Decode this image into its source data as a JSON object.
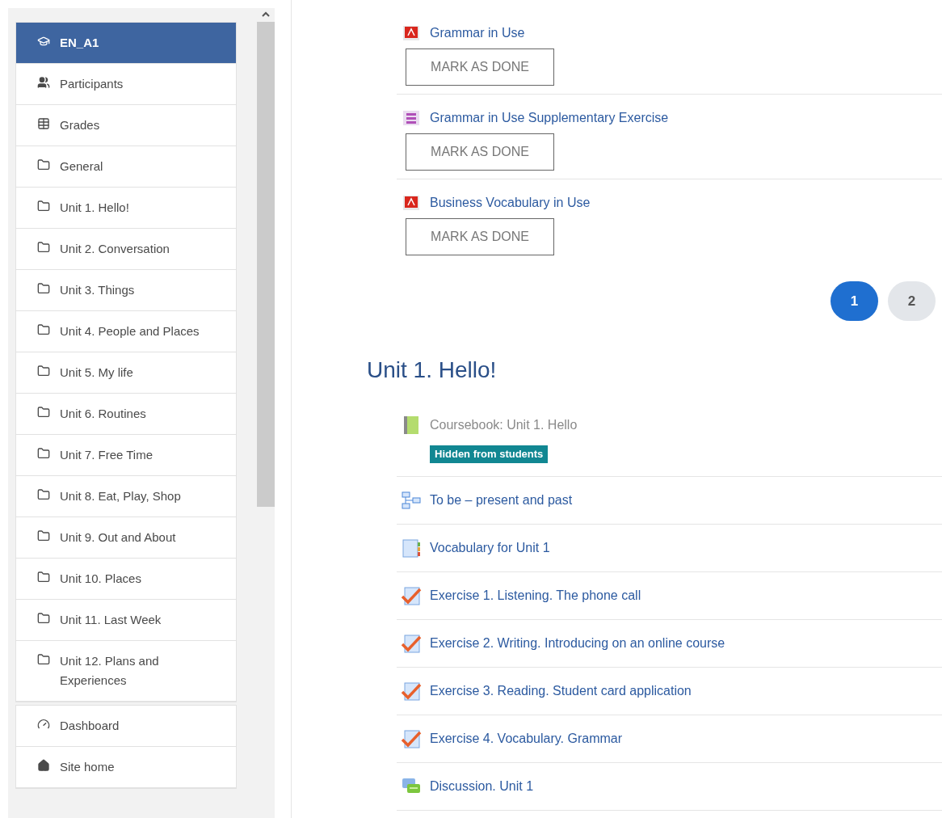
{
  "sidebar": {
    "groups": [
      {
        "items": [
          {
            "kind": "course",
            "label": "EN_A1",
            "selected": true
          },
          {
            "kind": "participants",
            "label": "Participants",
            "selected": false
          },
          {
            "kind": "grades",
            "label": "Grades",
            "selected": false
          },
          {
            "kind": "folder",
            "label": "General",
            "selected": false
          },
          {
            "kind": "folder",
            "label": "Unit 1. Hello!",
            "selected": false
          },
          {
            "kind": "folder",
            "label": "Unit 2. Conversation",
            "selected": false
          },
          {
            "kind": "folder",
            "label": "Unit 3. Things",
            "selected": false
          },
          {
            "kind": "folder",
            "label": "Unit 4. People and Places",
            "selected": false
          },
          {
            "kind": "folder",
            "label": "Unit 5. My life",
            "selected": false
          },
          {
            "kind": "folder",
            "label": "Unit 6. Routines",
            "selected": false
          },
          {
            "kind": "folder",
            "label": "Unit 7. Free Time",
            "selected": false
          },
          {
            "kind": "folder",
            "label": "Unit 8. Eat, Play, Shop",
            "selected": false
          },
          {
            "kind": "folder",
            "label": "Unit 9. Out and About",
            "selected": false
          },
          {
            "kind": "folder",
            "label": "Unit 10. Places",
            "selected": false
          },
          {
            "kind": "folder",
            "label": "Unit 11. Last Week",
            "selected": false
          },
          {
            "kind": "folder",
            "label": "Unit 12. Plans and Experiences",
            "selected": false
          }
        ]
      },
      {
        "items": [
          {
            "kind": "dashboard",
            "label": "Dashboard",
            "selected": false
          },
          {
            "kind": "home",
            "label": "Site home",
            "selected": false
          }
        ]
      }
    ]
  },
  "activities": [
    {
      "kind": "pdf",
      "title": "Grammar in Use",
      "button": "MARK AS DONE"
    },
    {
      "kind": "page",
      "title": "Grammar in Use Supplementary Exercise",
      "button": "MARK AS DONE"
    },
    {
      "kind": "pdf",
      "title": "Business Vocabulary in Use",
      "button": "MARK AS DONE"
    }
  ],
  "pagination": [
    {
      "label": "1",
      "selected": true
    },
    {
      "label": "2",
      "selected": false
    }
  ],
  "section": {
    "title": "Unit 1. Hello!",
    "activities": [
      {
        "kind": "book",
        "title": "Coursebook: Unit 1. Hello",
        "hidden": true,
        "badge": "Hidden from students"
      },
      {
        "kind": "lesson",
        "title": "To be – present and past",
        "hidden": false
      },
      {
        "kind": "glossary",
        "title": "Vocabulary for Unit 1",
        "hidden": false
      },
      {
        "kind": "quiz",
        "title": "Exercise 1. Listening. The phone call",
        "hidden": false
      },
      {
        "kind": "quiz",
        "title": "Exercise 2. Writing. Introducing on an online course",
        "hidden": false
      },
      {
        "kind": "quiz",
        "title": "Exercise 3. Reading. Student card application",
        "hidden": false
      },
      {
        "kind": "quiz",
        "title": "Exercise 4. Vocabulary. Grammar",
        "hidden": false
      },
      {
        "kind": "forum",
        "title": "Discussion. Unit 1",
        "hidden": false
      }
    ]
  }
}
